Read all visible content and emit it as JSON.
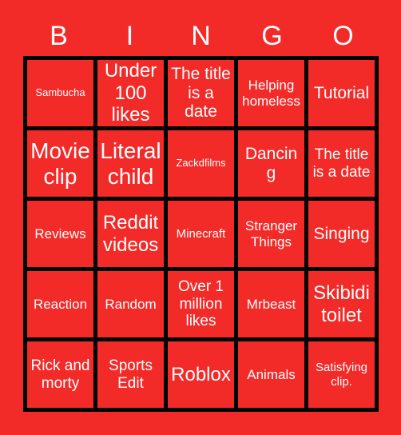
{
  "colors": {
    "background": "#F22A28",
    "cell_fill": "#F22A28",
    "grid_line": "#000000",
    "text": "#FFFFFF"
  },
  "header": {
    "letters": [
      "B",
      "I",
      "N",
      "G",
      "O"
    ]
  },
  "grid": {
    "rows": 5,
    "columns": 5
  },
  "cells": [
    {
      "text": "Sambucha",
      "size": "fs-xs"
    },
    {
      "text": "Under 100 likes",
      "size": "fs-xxl"
    },
    {
      "text": "The title is a date",
      "size": "fs-xl"
    },
    {
      "text": "Helping homeless",
      "size": "fs-md"
    },
    {
      "text": "Tutorial",
      "size": "fs-xl"
    },
    {
      "text": "Movie clip",
      "size": "fs-huge"
    },
    {
      "text": "Literal child",
      "size": "fs-huge"
    },
    {
      "text": "Zackdfilms",
      "size": "fs-xs"
    },
    {
      "text": "Dancing",
      "size": "fs-xl"
    },
    {
      "text": "The title is a date",
      "size": "fs-lg"
    },
    {
      "text": "Reviews",
      "size": "fs-md"
    },
    {
      "text": "Reddit videos",
      "size": "fs-xxl"
    },
    {
      "text": "Minecraft",
      "size": "fs-sm"
    },
    {
      "text": "Stranger Things",
      "size": "fs-md"
    },
    {
      "text": "Singing",
      "size": "fs-xl"
    },
    {
      "text": "Reaction",
      "size": "fs-md"
    },
    {
      "text": "Random",
      "size": "fs-md"
    },
    {
      "text": "Over 1 million likes",
      "size": "fs-lg"
    },
    {
      "text": "Mrbeast",
      "size": "fs-md"
    },
    {
      "text": "Skibidi toilet",
      "size": "fs-xxl"
    },
    {
      "text": "Rick and morty",
      "size": "fs-lg"
    },
    {
      "text": "Sports Edit",
      "size": "fs-lg"
    },
    {
      "text": "Roblox",
      "size": "fs-xxl"
    },
    {
      "text": "Animals",
      "size": "fs-md"
    },
    {
      "text": "Satisfying clip.",
      "size": "fs-sm"
    }
  ]
}
